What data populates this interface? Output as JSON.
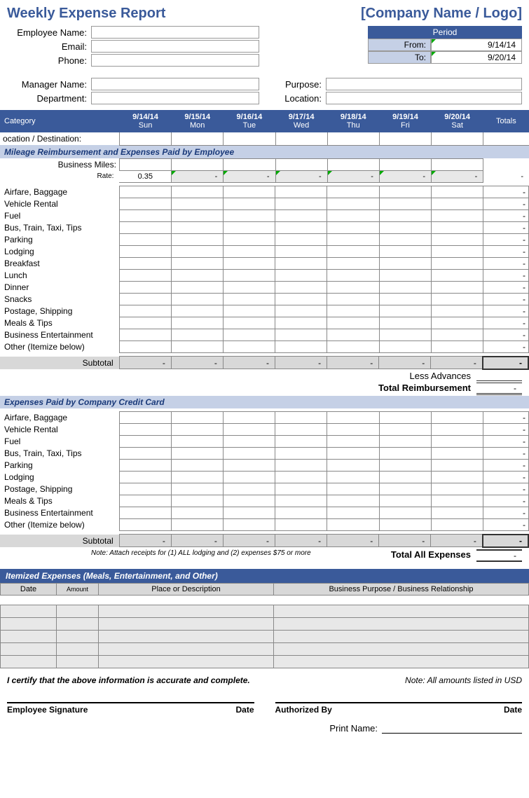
{
  "header": {
    "title": "Weekly Expense Report",
    "company": "[Company Name / Logo]"
  },
  "employee": {
    "name_label": "Employee Name:",
    "email_label": "Email:",
    "phone_label": "Phone:",
    "manager_label": "Manager Name:",
    "department_label": "Department:"
  },
  "period": {
    "header": "Period",
    "from_label": "From:",
    "from_value": "9/14/14",
    "to_label": "To:",
    "to_value": "9/20/14"
  },
  "purpose_label": "Purpose:",
  "location_label": "Location:",
  "table": {
    "category_hdr": "Category",
    "totals_hdr": "Totals",
    "days": [
      {
        "date": "9/14/14",
        "dow": "Sun"
      },
      {
        "date": "9/15/14",
        "dow": "Mon"
      },
      {
        "date": "9/16/14",
        "dow": "Tue"
      },
      {
        "date": "9/17/14",
        "dow": "Wed"
      },
      {
        "date": "9/18/14",
        "dow": "Thu"
      },
      {
        "date": "9/19/14",
        "dow": "Fri"
      },
      {
        "date": "9/20/14",
        "dow": "Sat"
      }
    ],
    "loc_dest": "ocation / Destination:"
  },
  "section1": {
    "header": "Mileage Reimbursement and Expenses Paid by Employee",
    "business_miles": "Business Miles:",
    "rate_label": "Rate:",
    "rate_value": "0.35",
    "dash": "-",
    "rows": [
      "Airfare, Baggage",
      "Vehicle Rental",
      "Fuel",
      "Bus, Train, Taxi, Tips",
      "Parking",
      "Lodging",
      "Breakfast",
      "Lunch",
      "Dinner",
      "Snacks",
      "Postage, Shipping",
      "Meals & Tips",
      "Business Entertainment",
      "Other (Itemize below)"
    ],
    "subtotal": "Subtotal",
    "less_advances": "Less Advances",
    "total_reimb": "Total Reimbursement"
  },
  "section2": {
    "header": "Expenses Paid by Company Credit Card",
    "rows": [
      "Airfare, Baggage",
      "Vehicle Rental",
      "Fuel",
      "Bus, Train, Taxi, Tips",
      "Parking",
      "Lodging",
      "Postage, Shipping",
      "Meals & Tips",
      "Business Entertainment",
      "Other (Itemize below)"
    ],
    "subtotal": "Subtotal",
    "note": "Note:  Attach receipts for (1) ALL lodging and (2) expenses $75 or more",
    "total_all": "Total All Expenses"
  },
  "itemized": {
    "header": "Itemized Expenses (Meals, Entertainment, and Other)",
    "cols": [
      "Date",
      "Amount",
      "Place or Description",
      "Business Purpose / Business Relationship"
    ]
  },
  "cert": {
    "text": "I certify that the above information is accurate and complete.",
    "note": "Note: All amounts listed in USD"
  },
  "sig": {
    "emp": "Employee Signature",
    "auth": "Authorized By",
    "date": "Date",
    "print": "Print Name:"
  }
}
